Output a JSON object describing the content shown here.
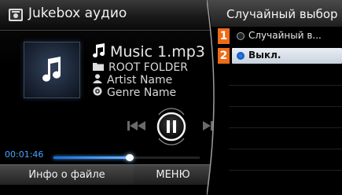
{
  "header": {
    "title": "Jukebox аудио",
    "icon": "jukebox-icon"
  },
  "track": {
    "filename": "Music 1.mp3",
    "folder": "ROOT FOLDER",
    "artist": "Artist Name",
    "genre": "Genre Name"
  },
  "playback": {
    "time": "00:01:46",
    "progress": 0.52
  },
  "bottom": {
    "info_label": "Инфо о файле",
    "menu_label": "МЕНЮ"
  },
  "popup": {
    "title": "Случайный выбор",
    "options": [
      {
        "number": "1",
        "label": "Случайный в...",
        "selected": false
      },
      {
        "number": "2",
        "label": "Выкл.",
        "selected": true
      }
    ]
  },
  "colors": {
    "accent": "#4aa3ff",
    "number_badge": "#ee6b18",
    "selected_row": "#e3e9f0"
  }
}
